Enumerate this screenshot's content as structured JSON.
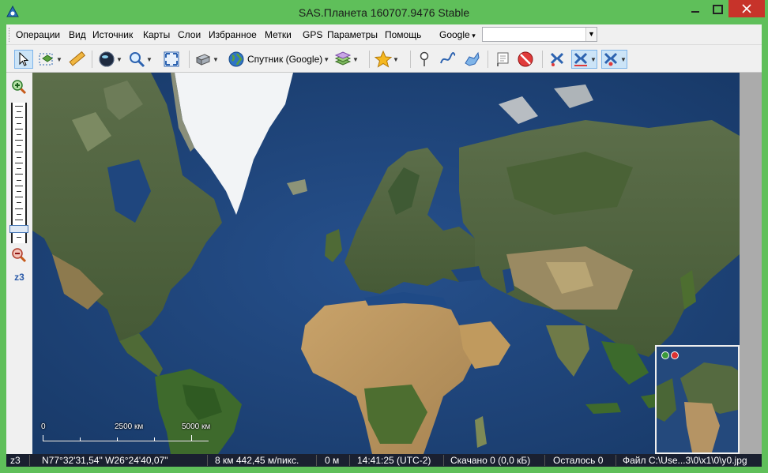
{
  "window": {
    "title": "SAS.Планета 160707.9476 Stable"
  },
  "menu": {
    "items": [
      "Операции",
      "Вид",
      "Источник",
      "Карты",
      "Слои",
      "Избранное",
      "Метки",
      "GPS",
      "Параметры",
      "Помощь"
    ],
    "search_engine": "Google",
    "search_value": ""
  },
  "toolbar": {
    "map_source_label": "Спутник (Google)",
    "icons": [
      "select-arrow",
      "area-select",
      "ruler",
      "globe-nav",
      "zoom-magnifier",
      "fullscreen",
      "server-source",
      "globe-map",
      "layers",
      "favorites-star",
      "marker-pin",
      "path",
      "polygon",
      "mark-edit",
      "no-entry",
      "gps-satellite",
      "gps-track",
      "gps-center"
    ]
  },
  "zoom": {
    "level_label": "z3",
    "level_fraction": 0.08
  },
  "scale": {
    "labels": [
      "0",
      "2500 км",
      "5000 км"
    ]
  },
  "status": {
    "zoom": "z3",
    "coords": "N77°32'31,54\" W26°24'40,07\"",
    "resolution": "8 км 442,45 м/пикс.",
    "distance": "0 м",
    "time": "14:41:25 (UTC-2)",
    "downloaded": "Скачано 0 (0,0 кБ)",
    "remaining": "Осталось 0",
    "file": "Файл C:\\Use...3\\0\\x1\\0\\y0.jpg"
  }
}
